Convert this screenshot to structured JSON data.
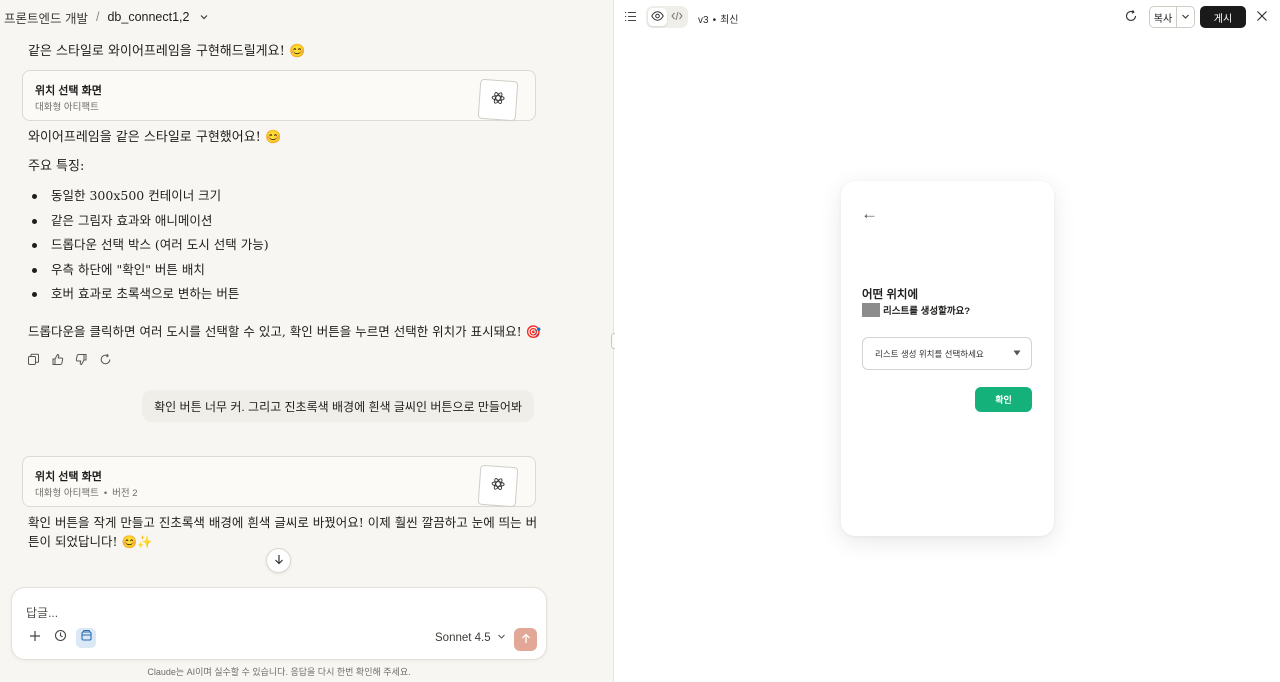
{
  "header": {
    "breadcrumb": "프론트엔드 개발",
    "separator": "/",
    "project": "db_connect1,2"
  },
  "chat": {
    "intro": "같은 스타일로 와이어프레임을 구현해드릴게요! 😊",
    "artifact1": {
      "title": "위치 선택 화면",
      "subtitle": "대화형 아티팩트"
    },
    "summary": "와이어프레임을 같은 스타일로 구현했어요! 😊",
    "features_heading": "주요 특징:",
    "features": [
      "동일한 300x500 컨테이너 크기",
      "같은 그림자 효과와 애니메이션",
      "드롭다운 선택 박스 (여러 도시 선택 가능)",
      "우측 하단에 \"확인\" 버튼 배치",
      "호버 효과로 초록색으로 변하는 버튼"
    ],
    "outro": "드롭다운을 클릭하면 여러 도시를 선택할 수 있고, 확인 버튼을 누르면 선택한 위치가 표시돼요! 🎯",
    "user_message": "확인 버튼 너무 커. 그리고 진초록색 배경에 흰색 글씨인 버튼으로 만들어봐",
    "artifact2": {
      "title": "위치 선택 화면",
      "subtitle": "대화형 아티팩트",
      "version": "버전 2"
    },
    "reply_line1": "확인 버튼을 작게 만들고 진초록색 배경에 흰색 글씨로 바꿨어요! 이제 훨씬 깔끔하고 눈에 띄는 버",
    "reply_line2": "튼이 되었답니다! 😊✨"
  },
  "composer": {
    "placeholder": "답글...",
    "model": "Sonnet 4.5"
  },
  "disclaimer": "Claude는 AI이며 실수할 수 있습니다. 응답을 다시 한번 확인해 주세요.",
  "preview_bar": {
    "version": "v3",
    "bullet": "•",
    "status": "최신",
    "copy_label": "복사",
    "publish_label": "게시"
  },
  "preview": {
    "back_arrow": "←",
    "question_line1": "어떤 위치에",
    "question_line2": "리스트를 생성할까요?",
    "select_placeholder": "리스트 생성 위치를 선택하세요",
    "confirm_label": "확인"
  },
  "colors": {
    "confirm_green": "#14b17a",
    "send_button": "#e3a797",
    "publish_button": "#1a1a1a",
    "left_background": "#f7f6f2"
  }
}
